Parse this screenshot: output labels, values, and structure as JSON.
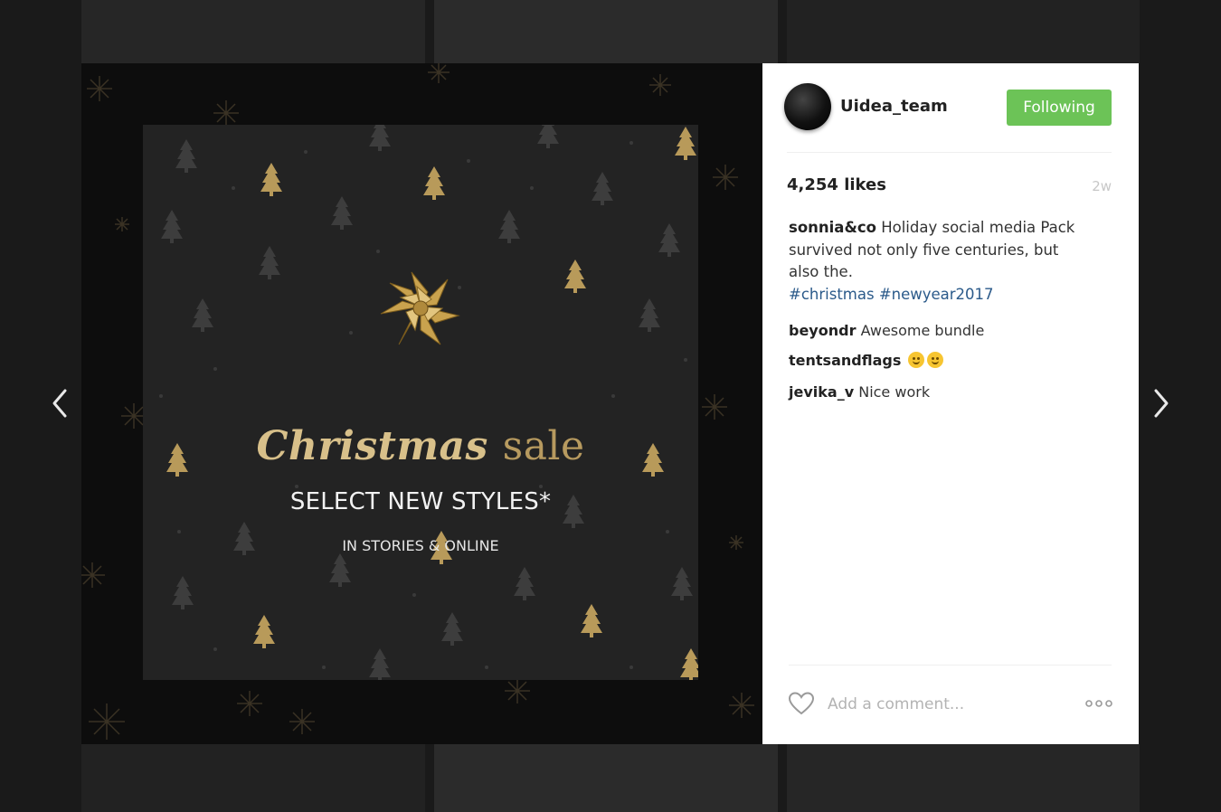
{
  "post": {
    "username": "Uidea_team",
    "follow_label": "Following",
    "likes": "4,254 likes",
    "time": "2w",
    "caption": {
      "author": "sonnia&co",
      "text": "Holiday social media Pack survived not only five centuries, but also the.",
      "hashtags": "#christmas #newyear2017"
    },
    "comments": [
      {
        "user": "beyondr",
        "text": "Awesome bundle"
      },
      {
        "user": "tentsandflags",
        "text": ""
      },
      {
        "user": "jevika_v",
        "text": "Nice work"
      }
    ],
    "add_comment_placeholder": "Add a comment..."
  },
  "image": {
    "title_part1": "Christmas",
    "title_part2": "sale",
    "subtitle": "SELECT NEW STYLES*",
    "subtitle2": "IN STORIES & ONLINE"
  },
  "colors": {
    "follow_button": "#6cc357",
    "hashtag": "#2b5a8a",
    "gold": "#d8c08a"
  },
  "icons": [
    "chevron-left-icon",
    "chevron-right-icon",
    "heart-icon",
    "more-dots-icon",
    "gift-bow-icon"
  ]
}
